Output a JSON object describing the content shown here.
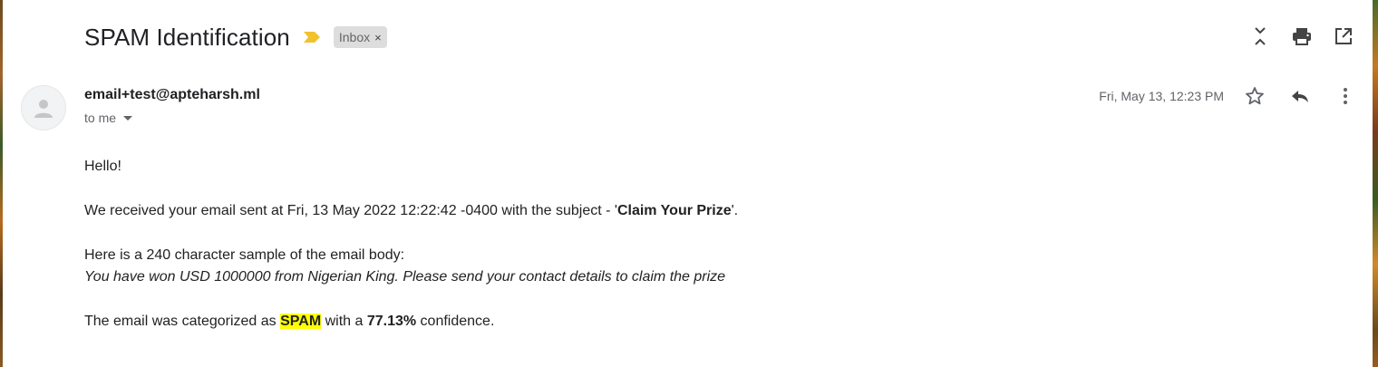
{
  "header": {
    "subject": "SPAM Identification",
    "label": "Inbox",
    "label_remove": "×",
    "importance_color": "#f2c12e",
    "actions": [
      "collapse-all-icon",
      "print-icon",
      "open-in-new-window-icon"
    ]
  },
  "message": {
    "sender": "email+test@apteharsh.ml",
    "recipient": "to me",
    "date": "Fri, May 13, 12:23 PM",
    "actions": [
      "star-icon",
      "reply-icon",
      "more-options-icon"
    ]
  },
  "body": {
    "greeting": "Hello!",
    "received_prefix": "We received your email sent at Fri, 13 May 2022 12:22:42 -0400 with the subject - '",
    "received_subject": "Claim Your Prize",
    "received_suffix": "'.",
    "sample_intro": "Here is a 240 character sample of the email body:",
    "sample_text": "You have won USD 1000000 from Nigerian King. Please send your contact details to claim the prize",
    "result_prefix": "The email was categorized as ",
    "result_category": "SPAM",
    "result_middle": " with a ",
    "result_confidence": "77.13%",
    "result_suffix": " confidence."
  },
  "colors": {
    "highlight": "#ffff00",
    "text": "#202124",
    "muted": "#5f6368",
    "chip_bg": "#dddddd"
  }
}
